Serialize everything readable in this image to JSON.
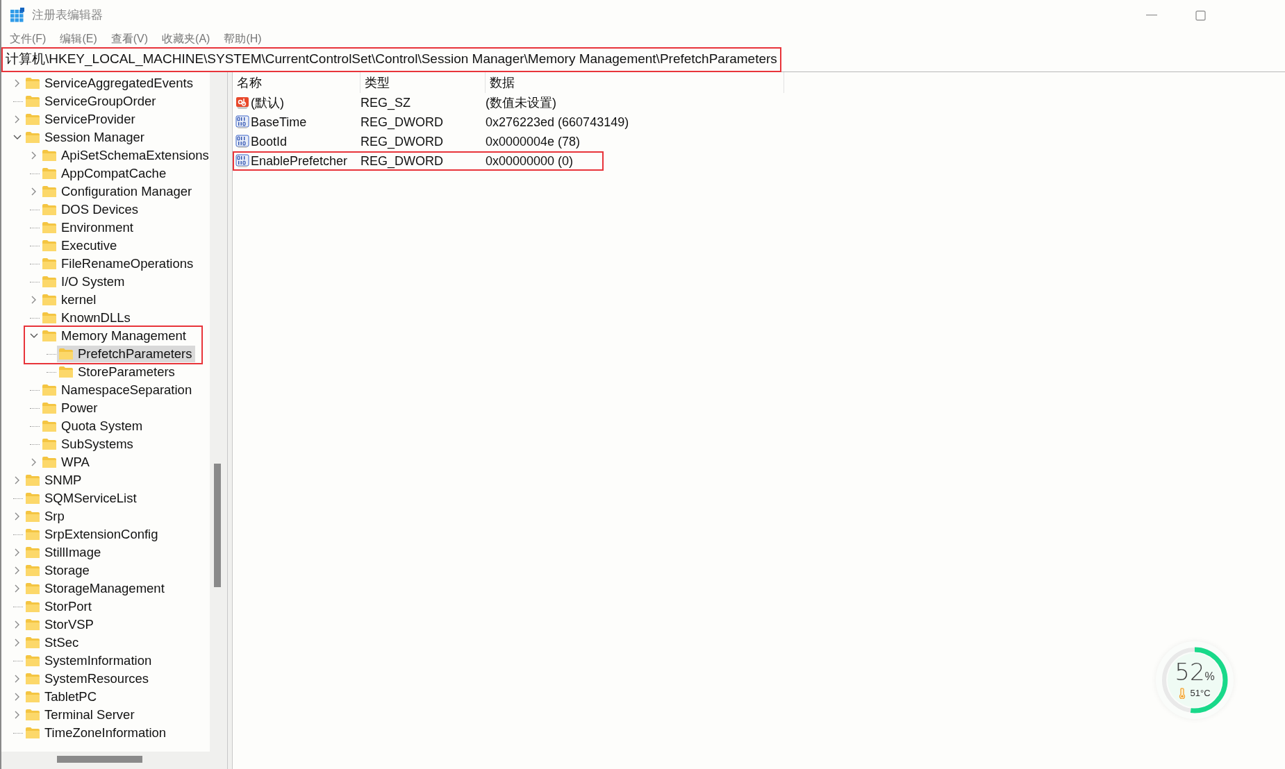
{
  "window": {
    "title": "注册表编辑器"
  },
  "menu": [
    "文件(F)",
    "编辑(E)",
    "查看(V)",
    "收藏夹(A)",
    "帮助(H)"
  ],
  "address_bar": {
    "value": "计算机\\HKEY_LOCAL_MACHINE\\SYSTEM\\CurrentControlSet\\Control\\Session Manager\\Memory Management\\PrefetchParameters",
    "highlighted": true
  },
  "tree": [
    {
      "label": "ServiceAggregatedEvents",
      "expandable": true,
      "expanded": false,
      "selected": false,
      "highlighted": false
    },
    {
      "label": "ServiceGroupOrder",
      "expandable": false,
      "selected": false,
      "highlighted": false
    },
    {
      "label": "ServiceProvider",
      "expandable": true,
      "expanded": false,
      "selected": false,
      "highlighted": false
    },
    {
      "label": "Session Manager",
      "expandable": true,
      "expanded": true,
      "selected": false,
      "highlighted": false,
      "children": [
        {
          "label": "ApiSetSchemaExtensions",
          "expandable": true,
          "expanded": false,
          "selected": false,
          "highlighted": false
        },
        {
          "label": "AppCompatCache",
          "expandable": false,
          "selected": false,
          "highlighted": false
        },
        {
          "label": "Configuration Manager",
          "expandable": true,
          "expanded": false,
          "selected": false,
          "highlighted": false
        },
        {
          "label": "DOS Devices",
          "expandable": false,
          "selected": false,
          "highlighted": false
        },
        {
          "label": "Environment",
          "expandable": false,
          "selected": false,
          "highlighted": false
        },
        {
          "label": "Executive",
          "expandable": false,
          "selected": false,
          "highlighted": false
        },
        {
          "label": "FileRenameOperations",
          "expandable": false,
          "selected": false,
          "highlighted": false
        },
        {
          "label": "I/O System",
          "expandable": false,
          "selected": false,
          "highlighted": false
        },
        {
          "label": "kernel",
          "expandable": true,
          "expanded": false,
          "selected": false,
          "highlighted": false
        },
        {
          "label": "KnownDLLs",
          "expandable": false,
          "selected": false,
          "highlighted": false
        },
        {
          "label": "Memory Management",
          "expandable": true,
          "expanded": true,
          "selected": false,
          "highlighted": true,
          "children": [
            {
              "label": "PrefetchParameters",
              "expandable": false,
              "selected": true,
              "highlighted": true
            },
            {
              "label": "StoreParameters",
              "expandable": false,
              "selected": false,
              "highlighted": false
            }
          ]
        },
        {
          "label": "NamespaceSeparation",
          "expandable": false,
          "selected": false,
          "highlighted": false
        },
        {
          "label": "Power",
          "expandable": false,
          "selected": false,
          "highlighted": false
        },
        {
          "label": "Quota System",
          "expandable": false,
          "selected": false,
          "highlighted": false
        },
        {
          "label": "SubSystems",
          "expandable": false,
          "selected": false,
          "highlighted": false
        },
        {
          "label": "WPA",
          "expandable": true,
          "expanded": false,
          "selected": false,
          "highlighted": false
        }
      ]
    },
    {
      "label": "SNMP",
      "expandable": true,
      "expanded": false,
      "selected": false,
      "highlighted": false
    },
    {
      "label": "SQMServiceList",
      "expandable": false,
      "selected": false,
      "highlighted": false
    },
    {
      "label": "Srp",
      "expandable": true,
      "expanded": false,
      "selected": false,
      "highlighted": false
    },
    {
      "label": "SrpExtensionConfig",
      "expandable": false,
      "selected": false,
      "highlighted": false
    },
    {
      "label": "StillImage",
      "expandable": true,
      "expanded": false,
      "selected": false,
      "highlighted": false
    },
    {
      "label": "Storage",
      "expandable": true,
      "expanded": false,
      "selected": false,
      "highlighted": false
    },
    {
      "label": "StorageManagement",
      "expandable": true,
      "expanded": false,
      "selected": false,
      "highlighted": false
    },
    {
      "label": "StorPort",
      "expandable": false,
      "selected": false,
      "highlighted": false
    },
    {
      "label": "StorVSP",
      "expandable": true,
      "expanded": false,
      "selected": false,
      "highlighted": false
    },
    {
      "label": "StSec",
      "expandable": true,
      "expanded": false,
      "selected": false,
      "highlighted": false
    },
    {
      "label": "SystemInformation",
      "expandable": false,
      "selected": false,
      "highlighted": false
    },
    {
      "label": "SystemResources",
      "expandable": true,
      "expanded": false,
      "selected": false,
      "highlighted": false
    },
    {
      "label": "TabletPC",
      "expandable": true,
      "expanded": false,
      "selected": false,
      "highlighted": false
    },
    {
      "label": "Terminal Server",
      "expandable": true,
      "expanded": false,
      "selected": false,
      "highlighted": false
    },
    {
      "label": "TimeZoneInformation",
      "expandable": false,
      "selected": false,
      "highlighted": false
    }
  ],
  "table": {
    "columns": [
      "名称",
      "类型",
      "数据"
    ],
    "rows": [
      {
        "kind": "string",
        "name": "(默认)",
        "type": "REG_SZ",
        "data": "(数值未设置)",
        "highlighted": false
      },
      {
        "kind": "dword",
        "name": "BaseTime",
        "type": "REG_DWORD",
        "data": "0x276223ed (660743149)",
        "highlighted": false
      },
      {
        "kind": "dword",
        "name": "BootId",
        "type": "REG_DWORD",
        "data": "0x0000004e (78)",
        "highlighted": false
      },
      {
        "kind": "dword",
        "name": "EnablePrefetcher",
        "type": "REG_DWORD",
        "data": "0x00000000 (0)",
        "highlighted": true
      }
    ]
  },
  "monitor_widget": {
    "level": 0.52,
    "value": "52",
    "unit": "%",
    "temperature": "51°C"
  }
}
